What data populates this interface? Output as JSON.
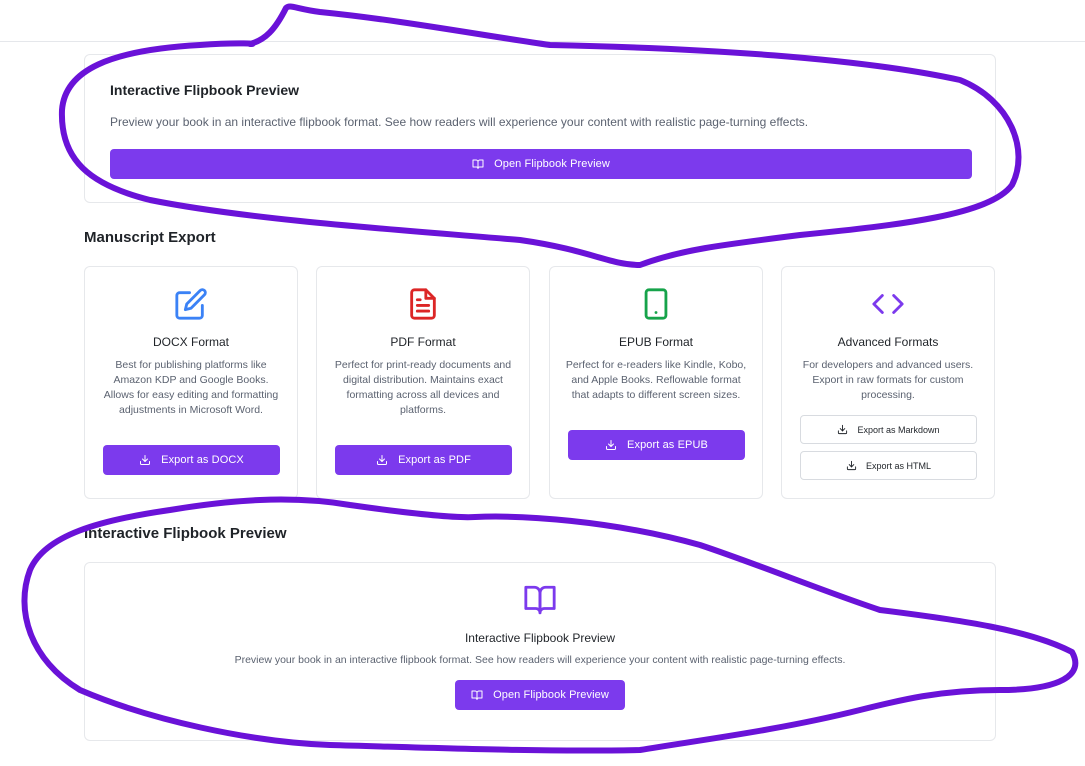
{
  "flipbook_top": {
    "title": "Interactive Flipbook Preview",
    "description": "Preview your book in an interactive flipbook format. See how readers will experience your content with realistic page-turning effects.",
    "button_label": "Open Flipbook Preview",
    "button_icon": "book-open-icon"
  },
  "export_section": {
    "title": "Manuscript Export",
    "cards": [
      {
        "title": "DOCX Format",
        "icon": "edit-icon",
        "icon_color": "#3b82f6",
        "description": "Best for publishing platforms like Amazon KDP and Google Books. Allows for easy editing and formatting adjustments in Microsoft Word.",
        "button_label": "Export as DOCX"
      },
      {
        "title": "PDF Format",
        "icon": "file-text-icon",
        "icon_color": "#dc2626",
        "description": "Perfect for print-ready documents and digital distribution. Maintains exact formatting across all devices and platforms.",
        "button_label": "Export as PDF"
      },
      {
        "title": "EPUB Format",
        "icon": "tablet-icon",
        "icon_color": "#16a34a",
        "description": "Perfect for e-readers like Kindle, Kobo, and Apple Books. Reflowable format that adapts to different screen sizes.",
        "button_label": "Export as EPUB"
      },
      {
        "title": "Advanced Formats",
        "icon": "code-icon",
        "icon_color": "#7c3aed",
        "description": "For developers and advanced users. Export in raw formats for custom processing.",
        "button_markdown": "Export as Markdown",
        "button_html": "Export as HTML"
      }
    ]
  },
  "flipbook_section": {
    "title": "Interactive Flipbook Preview",
    "card_title": "Interactive Flipbook Preview",
    "description": "Preview your book in an interactive flipbook format. See how readers will experience your content with realistic page-turning effects.",
    "button_label": "Open Flipbook Preview",
    "icon": "book-open-icon",
    "icon_color": "#7c3aed"
  },
  "colors": {
    "primary": "#7c3aed",
    "annotation_stroke": "#6a12d8"
  }
}
